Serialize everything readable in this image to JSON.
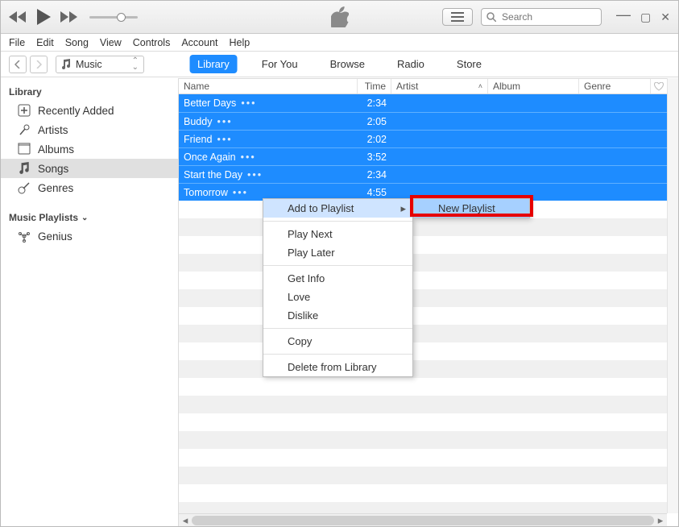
{
  "toolbar": {
    "search_placeholder": "Search"
  },
  "menubar": [
    "File",
    "Edit",
    "Song",
    "View",
    "Controls",
    "Account",
    "Help"
  ],
  "nav": {
    "dropdown_label": "Music",
    "tabs": [
      "Library",
      "For You",
      "Browse",
      "Radio",
      "Store"
    ],
    "active_tab_index": 0
  },
  "sidebar": {
    "section1_title": "Library",
    "section1_items": [
      {
        "label": "Recently Added",
        "icon": "plus-box-icon"
      },
      {
        "label": "Artists",
        "icon": "mic-icon"
      },
      {
        "label": "Albums",
        "icon": "album-icon"
      },
      {
        "label": "Songs",
        "icon": "note-icon",
        "selected": true
      },
      {
        "label": "Genres",
        "icon": "guitar-icon"
      }
    ],
    "section2_title": "Music Playlists",
    "section2_items": [
      {
        "label": "Genius",
        "icon": "genius-icon"
      }
    ]
  },
  "columns": {
    "name": "Name",
    "time": "Time",
    "artist": "Artist",
    "album": "Album",
    "genre": "Genre"
  },
  "songs": [
    {
      "name": "Better Days",
      "time": "2:34"
    },
    {
      "name": "Buddy",
      "time": "2:05"
    },
    {
      "name": "Friend",
      "time": "2:02"
    },
    {
      "name": "Once Again",
      "time": "3:52"
    },
    {
      "name": "Start the Day",
      "time": "2:34"
    },
    {
      "name": "Tomorrow",
      "time": "4:55"
    }
  ],
  "context_menu": {
    "items": [
      "Add to Playlist",
      "Play Next",
      "Play Later",
      "Get Info",
      "Love",
      "Dislike",
      "Copy",
      "Delete from Library"
    ],
    "highlighted_index": 0
  },
  "submenu": {
    "items": [
      "New Playlist"
    ],
    "highlighted_index": 0
  }
}
